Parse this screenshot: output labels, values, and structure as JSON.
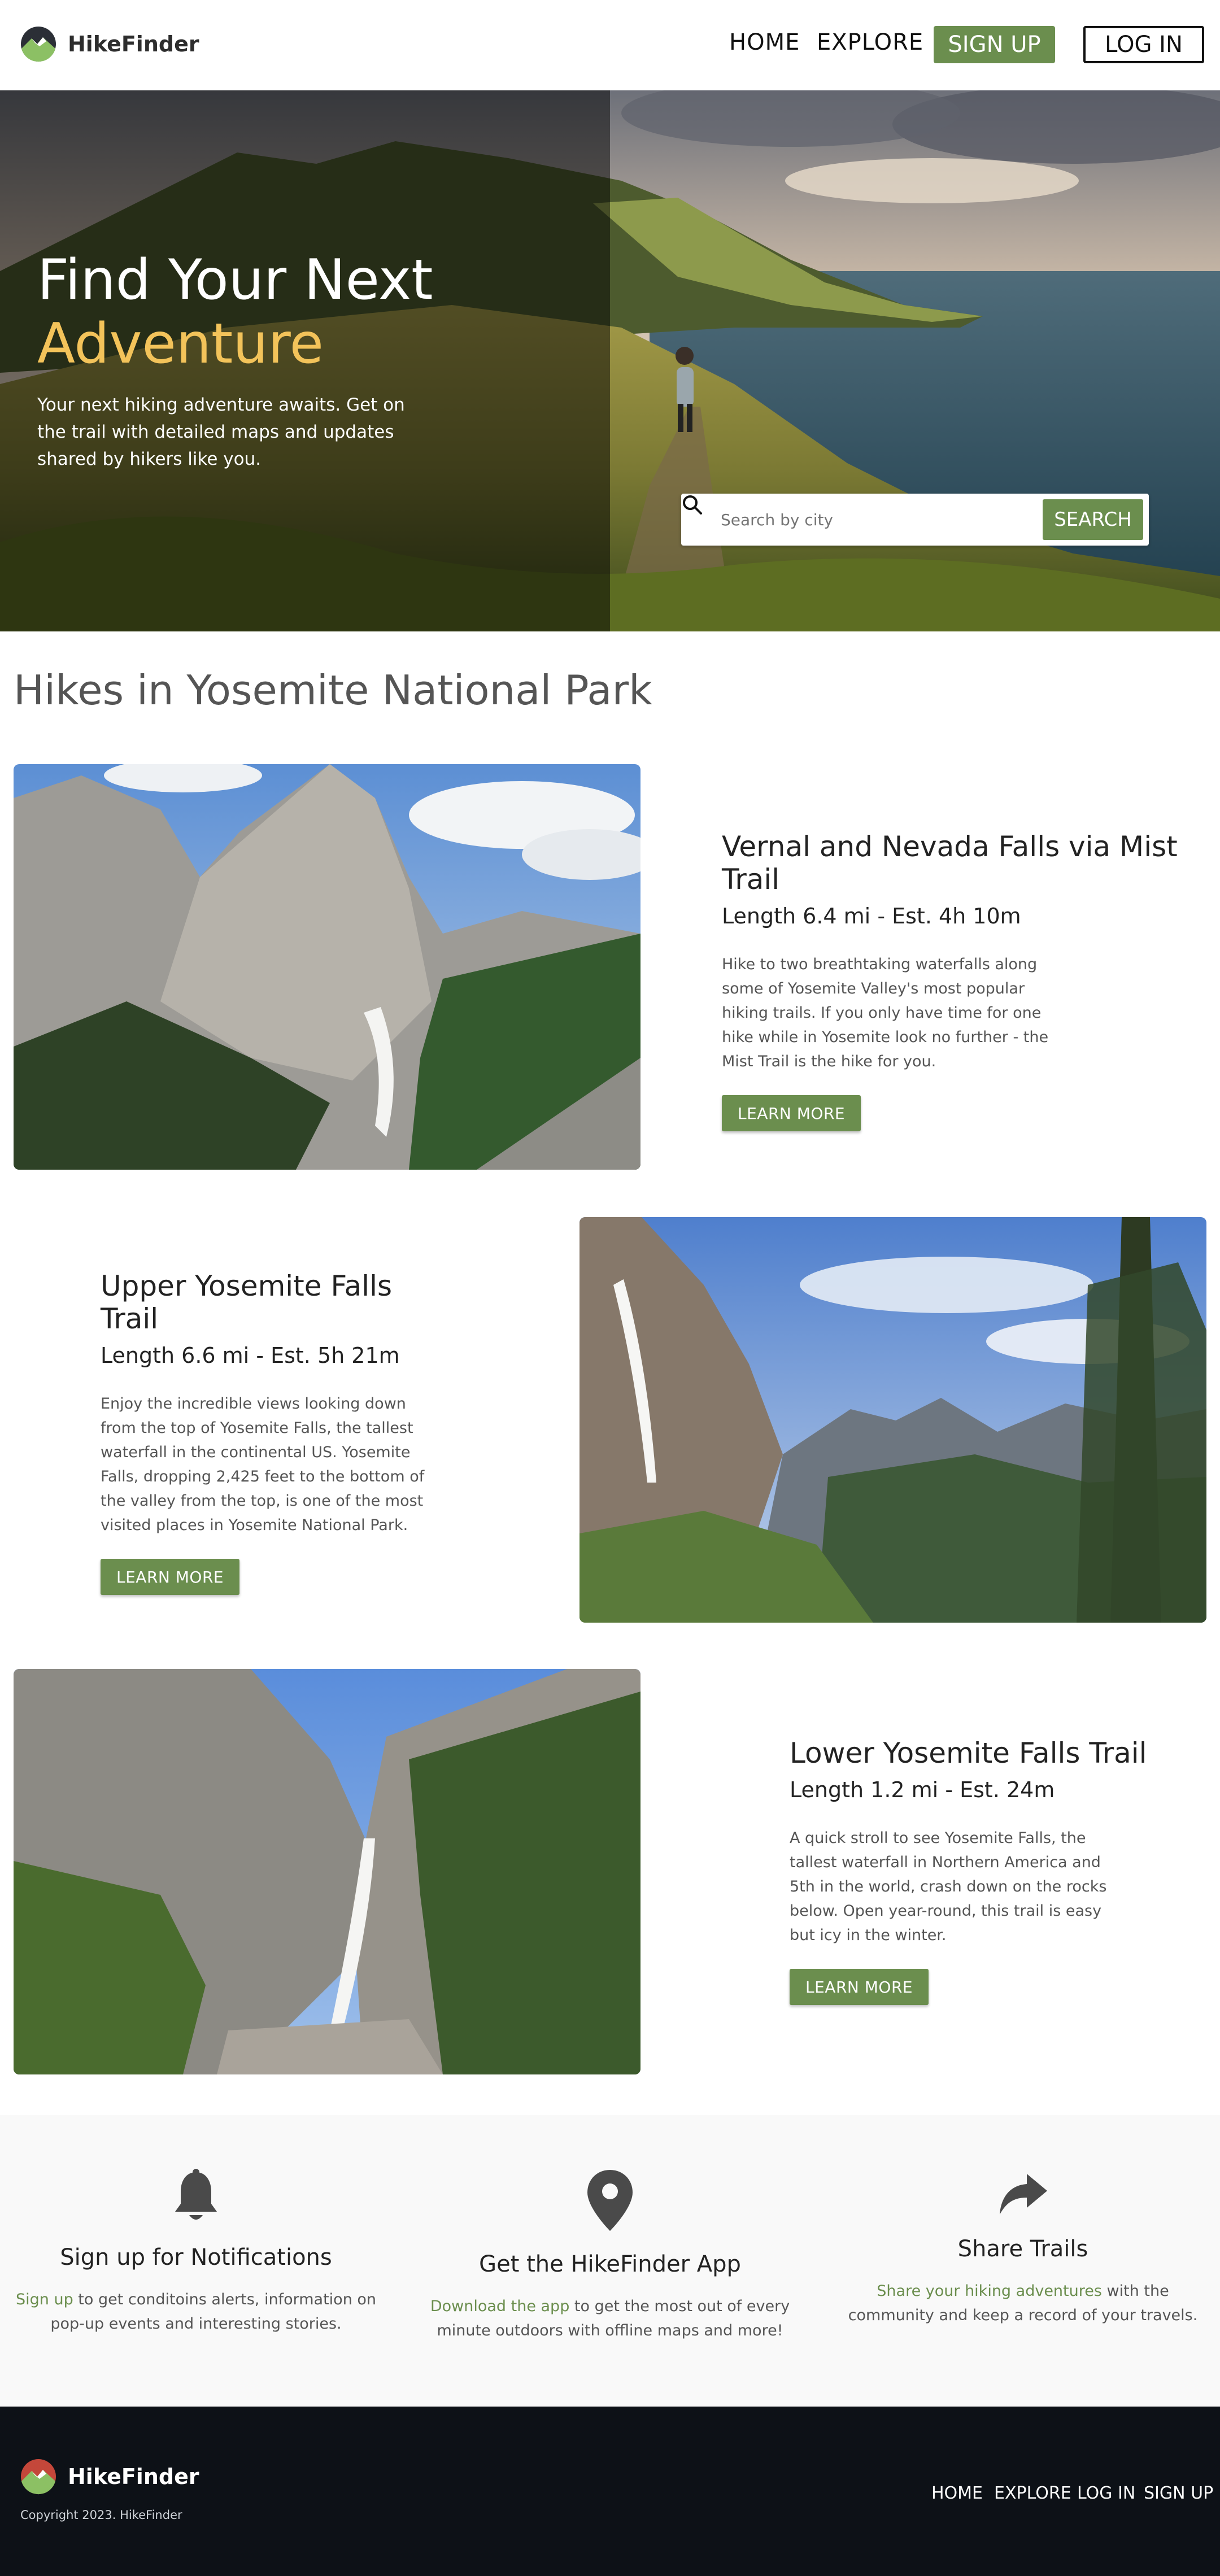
{
  "brand": "HikeFinder",
  "colors": {
    "accent_green": "#6b8e4e",
    "hero_accent": "#f3c35a",
    "footer_bg": "#0d1117"
  },
  "nav": {
    "home": "HOME",
    "explore": "EXPLORE",
    "signup": "SIGN UP",
    "login": "LOG IN"
  },
  "hero": {
    "title_line1": "Find Your Next",
    "title_line2": "Adventure",
    "subtitle": "Your next hiking adventure awaits. Get on the trail with detailed maps and updates shared by hikers like you.",
    "search_placeholder": "Search by city",
    "search_button": "SEARCH",
    "search_icon": "search-icon"
  },
  "section_title": "Hikes in Yosemite National Park",
  "hikes": [
    {
      "name": "Vernal and Nevada Falls via Mist Trail",
      "length": "Length 6.4 mi - Est. 4h 10m",
      "description": "Hike to two breathtaking waterfalls along some of Yosemite Valley's most popular hiking trails. If you only have time for one hike while in Yosemite look no further - the Mist Trail is the hike for you.",
      "button": "LEARN MORE"
    },
    {
      "name": "Upper Yosemite Falls Trail",
      "length": "Length 6.6 mi - Est. 5h 21m",
      "description": "Enjoy the incredible views looking down from the top of Yosemite Falls, the tallest waterfall in the continental US. Yosemite Falls, dropping 2,425 feet to the bottom of the valley from the top, is one of the most visited places in Yosemite National Park.",
      "button": "LEARN MORE"
    },
    {
      "name": "Lower Yosemite Falls Trail",
      "length": "Length 1.2 mi - Est. 24m",
      "description": "A quick stroll to see Yosemite Falls, the tallest waterfall in Northern America and 5th in the world, crash down on the rocks below. Open year-round, this trail is easy but icy in the winter.",
      "button": "LEARN MORE"
    }
  ],
  "features": [
    {
      "icon": "bell-icon",
      "title": "Sign up for Notifications",
      "link": "Sign up",
      "text": " to get conditoins alerts, information on pop-up events and interesting stories."
    },
    {
      "icon": "map-pin-icon",
      "title": "Get the HikeFinder App",
      "link": "Download the app",
      "text": " to get the most out of every minute outdoors with offline maps and more!"
    },
    {
      "icon": "share-icon",
      "title": "Share Trails",
      "link": "Share your hiking adventures",
      "text": " with the community and keep a record of your travels."
    }
  ],
  "footer": {
    "brand": "HikeFinder",
    "copyright": "Copyright 2023. HikeFinder",
    "links": {
      "home": "HOME",
      "explore": "EXPLORE",
      "login": "LOG IN",
      "signup": "SIGN UP"
    }
  }
}
